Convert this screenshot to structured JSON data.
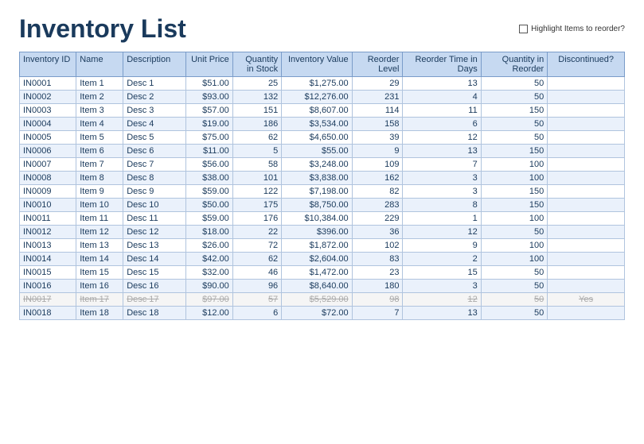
{
  "header": {
    "title": "Inventory List",
    "highlight_label": "Highlight Items to reorder?"
  },
  "columns": [
    {
      "label": "Inventory ID",
      "key": "id"
    },
    {
      "label": "Name",
      "key": "name"
    },
    {
      "label": "Description",
      "key": "desc"
    },
    {
      "label": "Unit Price",
      "key": "unit_price"
    },
    {
      "label": "Quantity in Stock",
      "key": "qty"
    },
    {
      "label": "Inventory Value",
      "key": "inv_value"
    },
    {
      "label": "Reorder Level",
      "key": "reorder_level"
    },
    {
      "label": "Reorder Time in Days",
      "key": "reorder_time"
    },
    {
      "label": "Quantity in Reorder",
      "key": "qty_reorder"
    },
    {
      "label": "Discontinued?",
      "key": "discontinued"
    }
  ],
  "rows": [
    {
      "id": "IN0001",
      "name": "Item 1",
      "desc": "Desc 1",
      "unit_price": "$51.00",
      "qty": "25",
      "inv_value": "$1,275.00",
      "reorder_level": "29",
      "reorder_time": "13",
      "qty_reorder": "50",
      "discontinued": "",
      "strikethrough": false
    },
    {
      "id": "IN0002",
      "name": "Item 2",
      "desc": "Desc 2",
      "unit_price": "$93.00",
      "qty": "132",
      "inv_value": "$12,276.00",
      "reorder_level": "231",
      "reorder_time": "4",
      "qty_reorder": "50",
      "discontinued": "",
      "strikethrough": false
    },
    {
      "id": "IN0003",
      "name": "Item 3",
      "desc": "Desc 3",
      "unit_price": "$57.00",
      "qty": "151",
      "inv_value": "$8,607.00",
      "reorder_level": "114",
      "reorder_time": "11",
      "qty_reorder": "150",
      "discontinued": "",
      "strikethrough": false
    },
    {
      "id": "IN0004",
      "name": "Item 4",
      "desc": "Desc 4",
      "unit_price": "$19.00",
      "qty": "186",
      "inv_value": "$3,534.00",
      "reorder_level": "158",
      "reorder_time": "6",
      "qty_reorder": "50",
      "discontinued": "",
      "strikethrough": false
    },
    {
      "id": "IN0005",
      "name": "Item 5",
      "desc": "Desc 5",
      "unit_price": "$75.00",
      "qty": "62",
      "inv_value": "$4,650.00",
      "reorder_level": "39",
      "reorder_time": "12",
      "qty_reorder": "50",
      "discontinued": "",
      "strikethrough": false
    },
    {
      "id": "IN0006",
      "name": "Item 6",
      "desc": "Desc 6",
      "unit_price": "$11.00",
      "qty": "5",
      "inv_value": "$55.00",
      "reorder_level": "9",
      "reorder_time": "13",
      "qty_reorder": "150",
      "discontinued": "",
      "strikethrough": false
    },
    {
      "id": "IN0007",
      "name": "Item 7",
      "desc": "Desc 7",
      "unit_price": "$56.00",
      "qty": "58",
      "inv_value": "$3,248.00",
      "reorder_level": "109",
      "reorder_time": "7",
      "qty_reorder": "100",
      "discontinued": "",
      "strikethrough": false
    },
    {
      "id": "IN0008",
      "name": "Item 8",
      "desc": "Desc 8",
      "unit_price": "$38.00",
      "qty": "101",
      "inv_value": "$3,838.00",
      "reorder_level": "162",
      "reorder_time": "3",
      "qty_reorder": "100",
      "discontinued": "",
      "strikethrough": false
    },
    {
      "id": "IN0009",
      "name": "Item 9",
      "desc": "Desc 9",
      "unit_price": "$59.00",
      "qty": "122",
      "inv_value": "$7,198.00",
      "reorder_level": "82",
      "reorder_time": "3",
      "qty_reorder": "150",
      "discontinued": "",
      "strikethrough": false
    },
    {
      "id": "IN0010",
      "name": "Item 10",
      "desc": "Desc 10",
      "unit_price": "$50.00",
      "qty": "175",
      "inv_value": "$8,750.00",
      "reorder_level": "283",
      "reorder_time": "8",
      "qty_reorder": "150",
      "discontinued": "",
      "strikethrough": false
    },
    {
      "id": "IN0011",
      "name": "Item 11",
      "desc": "Desc 11",
      "unit_price": "$59.00",
      "qty": "176",
      "inv_value": "$10,384.00",
      "reorder_level": "229",
      "reorder_time": "1",
      "qty_reorder": "100",
      "discontinued": "",
      "strikethrough": false
    },
    {
      "id": "IN0012",
      "name": "Item 12",
      "desc": "Desc 12",
      "unit_price": "$18.00",
      "qty": "22",
      "inv_value": "$396.00",
      "reorder_level": "36",
      "reorder_time": "12",
      "qty_reorder": "50",
      "discontinued": "",
      "strikethrough": false
    },
    {
      "id": "IN0013",
      "name": "Item 13",
      "desc": "Desc 13",
      "unit_price": "$26.00",
      "qty": "72",
      "inv_value": "$1,872.00",
      "reorder_level": "102",
      "reorder_time": "9",
      "qty_reorder": "100",
      "discontinued": "",
      "strikethrough": false
    },
    {
      "id": "IN0014",
      "name": "Item 14",
      "desc": "Desc 14",
      "unit_price": "$42.00",
      "qty": "62",
      "inv_value": "$2,604.00",
      "reorder_level": "83",
      "reorder_time": "2",
      "qty_reorder": "100",
      "discontinued": "",
      "strikethrough": false
    },
    {
      "id": "IN0015",
      "name": "Item 15",
      "desc": "Desc 15",
      "unit_price": "$32.00",
      "qty": "46",
      "inv_value": "$1,472.00",
      "reorder_level": "23",
      "reorder_time": "15",
      "qty_reorder": "50",
      "discontinued": "",
      "strikethrough": false
    },
    {
      "id": "IN0016",
      "name": "Item 16",
      "desc": "Desc 16",
      "unit_price": "$90.00",
      "qty": "96",
      "inv_value": "$8,640.00",
      "reorder_level": "180",
      "reorder_time": "3",
      "qty_reorder": "50",
      "discontinued": "",
      "strikethrough": false
    },
    {
      "id": "IN0017",
      "name": "Item 17",
      "desc": "Desc 17",
      "unit_price": "$97.00",
      "qty": "57",
      "inv_value": "$5,529.00",
      "reorder_level": "98",
      "reorder_time": "12",
      "qty_reorder": "50",
      "discontinued": "Yes",
      "strikethrough": true
    },
    {
      "id": "IN0018",
      "name": "Item 18",
      "desc": "Desc 18",
      "unit_price": "$12.00",
      "qty": "6",
      "inv_value": "$72.00",
      "reorder_level": "7",
      "reorder_time": "13",
      "qty_reorder": "50",
      "discontinued": "",
      "strikethrough": false
    }
  ]
}
